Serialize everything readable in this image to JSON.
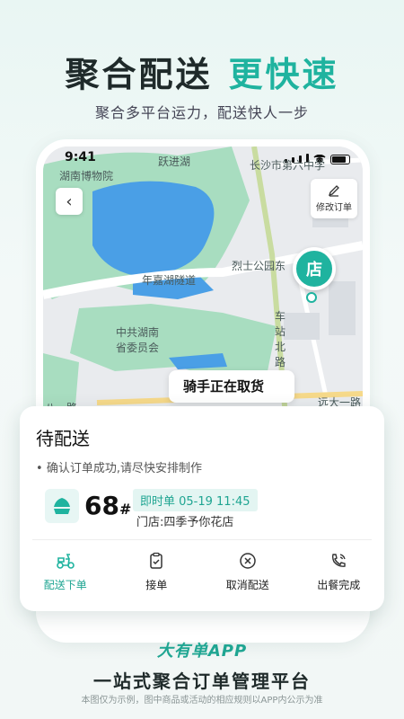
{
  "hero": {
    "title_left": "聚合配送",
    "title_right": "更快速",
    "subtitle": "聚合多平台运力，配送快人一步"
  },
  "status_bar": {
    "time": "9:41"
  },
  "map": {
    "labels": {
      "museum": "湖南博物院",
      "lake": "跃进湖",
      "school": "长沙市第六中学",
      "park": "烈士公园东",
      "tunnel": "年嘉湖隧道",
      "committee": "中共湖南省委员会",
      "road_n": "车站北路",
      "road_s": "远大一路",
      "road_w": "八一路"
    },
    "edit_order": "修改订单",
    "store_pin": "店",
    "rider_status": "骑手正在取货"
  },
  "order_card": {
    "title": "待配送",
    "note": "确认订单成功,请尽快安排制作",
    "number": "68",
    "number_suffix": "#",
    "tag": "即时单  05-19 11:45",
    "store": "门店:四季予你花店",
    "actions": [
      {
        "label": "配送下单",
        "icon": "delivery-scooter-icon",
        "active": true
      },
      {
        "label": "接单",
        "icon": "clipboard-check-icon",
        "active": false
      },
      {
        "label": "取消配送",
        "icon": "cancel-circle-icon",
        "active": false
      },
      {
        "label": "出餐完成",
        "icon": "phone-ring-icon",
        "active": false
      }
    ]
  },
  "footer": {
    "brand": "大有单APP",
    "slogan": "一站式聚合订单管理平台",
    "disclaimer": "本图仅为示例，图中商品或活动的相应规则以APP内公示为准"
  },
  "colors": {
    "accent": "#1fb39f",
    "text": "#1f2a2a"
  }
}
